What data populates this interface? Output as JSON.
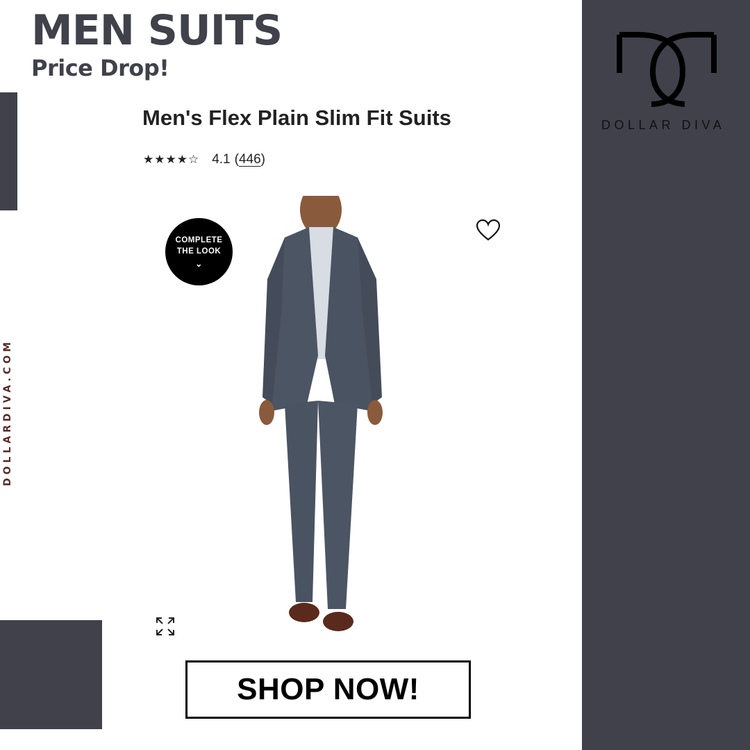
{
  "headline": "MEN SUITS",
  "subheadline": "Price Drop!",
  "site_url": "DOLLARDIVA.COM",
  "brand": {
    "logo_text": "DOLLAR DIVA",
    "panel_color": "#41414b"
  },
  "product": {
    "title": "Men's Flex Plain Slim Fit Suits",
    "stars": "★★★★☆",
    "rating_value": "4.1",
    "rating_open": "(",
    "review_count": "446",
    "rating_close": ")",
    "rating": 4.1,
    "badge_line1": "COMPLETE",
    "badge_line2": "THE LOOK",
    "badge_chevron": "⌄",
    "favorite_icon": "heart-icon",
    "zoom_icon": "expand-icon"
  },
  "cta": {
    "label": "SHOP NOW!"
  },
  "colors": {
    "accent_dark": "#41414b",
    "vertical_text": "#5a2a2a",
    "suit": "#4c5564",
    "shoes": "#5a2a1c"
  }
}
